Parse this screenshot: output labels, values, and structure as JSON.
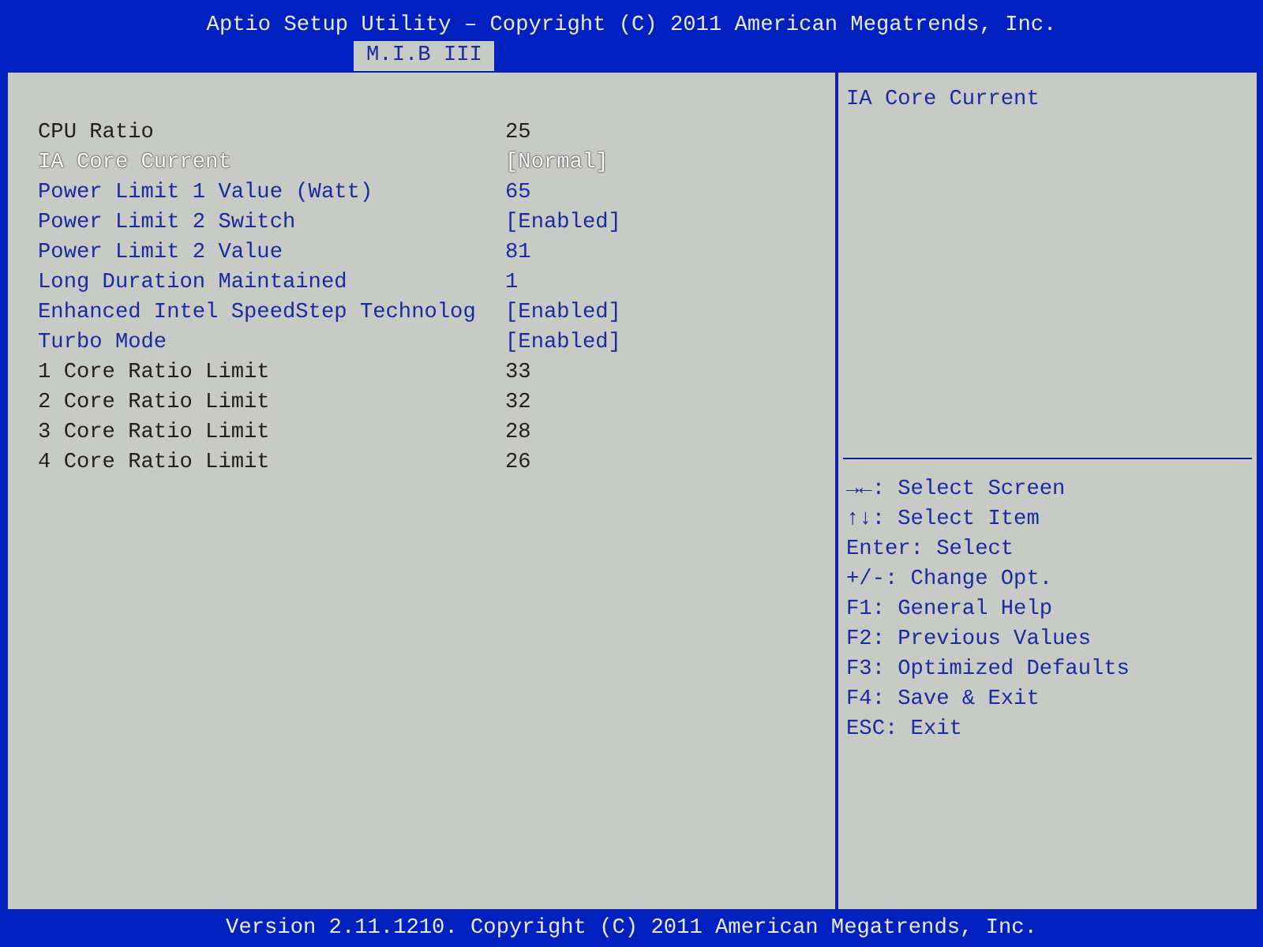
{
  "header": {
    "title": "Aptio Setup Utility – Copyright (C) 2011 American Megatrends, Inc."
  },
  "tabs": [
    {
      "label": "M.I.B III",
      "selected": true
    }
  ],
  "settings": [
    {
      "label": "CPU Ratio",
      "value": "25",
      "editable": false,
      "selected": false
    },
    {
      "label": "IA Core Current",
      "value": "[Normal]",
      "editable": true,
      "selected": true
    },
    {
      "label": "Power Limit 1 Value (Watt)",
      "value": "65",
      "editable": true,
      "selected": false
    },
    {
      "label": "Power Limit 2 Switch",
      "value": "[Enabled]",
      "editable": true,
      "selected": false
    },
    {
      "label": "Power Limit 2 Value",
      "value": "81",
      "editable": true,
      "selected": false
    },
    {
      "label": "Long Duration Maintained",
      "value": "1",
      "editable": true,
      "selected": false
    },
    {
      "label": "Enhanced Intel SpeedStep Technolog",
      "value": "[Enabled]",
      "editable": true,
      "selected": false
    },
    {
      "label": "Turbo Mode",
      "value": "[Enabled]",
      "editable": true,
      "selected": false
    },
    {
      "label": "1 Core Ratio Limit",
      "value": "33",
      "editable": false,
      "selected": false
    },
    {
      "label": "2 Core Ratio Limit",
      "value": "32",
      "editable": false,
      "selected": false
    },
    {
      "label": "3 Core Ratio Limit",
      "value": "28",
      "editable": false,
      "selected": false
    },
    {
      "label": "4 Core Ratio Limit",
      "value": "26",
      "editable": false,
      "selected": false
    }
  ],
  "help": {
    "text": "IA Core Current"
  },
  "key_hints": [
    "**→←**: Select Screen",
    "**↑↓**: Select Item",
    "Enter: Select",
    "+/-: Change Opt.",
    "F1: General Help",
    "F2: Previous Values",
    "F3: Optimized Defaults",
    "F4: Save & Exit",
    "ESC: Exit"
  ],
  "footer": {
    "text": "Version 2.11.1210. Copyright (C) 2011 American Megatrends, Inc."
  }
}
